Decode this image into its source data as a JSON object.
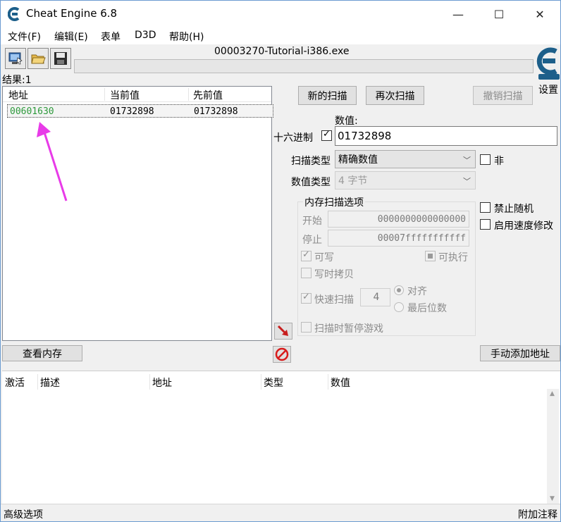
{
  "window": {
    "title": "Cheat Engine 6.8",
    "minimize_glyph": "—",
    "maximize_glyph": "☐",
    "close_glyph": "✕"
  },
  "menu": [
    "文件(F)",
    "编辑(E)",
    "表单",
    "D3D",
    "帮助(H)"
  ],
  "toolbar": {
    "process_title": "00003270-Tutorial-i386.exe",
    "settings_label": "设置",
    "icons": [
      "open-process-icon",
      "open-file-icon",
      "save-icon"
    ]
  },
  "results": {
    "label": "结果:1",
    "columns": [
      "地址",
      "当前值",
      "先前值"
    ],
    "rows": [
      {
        "address": "00601630",
        "current": "01732898",
        "previous": "01732898"
      }
    ]
  },
  "scan": {
    "new_scan": "新的扫描",
    "next_scan": "再次扫描",
    "undo_scan": "撤销扫描",
    "value_label": "数值:",
    "hex_label": "十六进制",
    "hex_checked": true,
    "value": "01732898",
    "scan_type_label": "扫描类型",
    "scan_type_value": "精确数值",
    "not_label": "非",
    "value_type_label": "数值类型",
    "value_type_value": "4 字节",
    "memory_options": {
      "title": "内存扫描选项",
      "start_label": "开始",
      "start_value": "0000000000000000",
      "stop_label": "停止",
      "stop_value": "00007fffffffffff",
      "writable_label": "可写",
      "executable_label": "可执行",
      "copy_on_write_label": "写时拷贝",
      "fast_scan_label": "快速扫描",
      "fast_scan_value": "4",
      "align_label": "对齐",
      "last_digits_label": "最后位数",
      "pause_label": "扫描时暂停游戏"
    },
    "disable_random_label": "禁止随机",
    "speedhack_label": "启用速度修改"
  },
  "buttons": {
    "view_memory": "查看内存",
    "add_address_manually": "手动添加地址"
  },
  "address_list": {
    "columns": [
      "激活",
      "描述",
      "地址",
      "类型",
      "数值"
    ]
  },
  "status": {
    "advanced_options": "高级选项",
    "table_comments": "附加注释"
  },
  "colors": {
    "address_green": "#2e9a3c",
    "arrow_magenta": "#e83be8",
    "title_border": "#6b9bd1"
  }
}
